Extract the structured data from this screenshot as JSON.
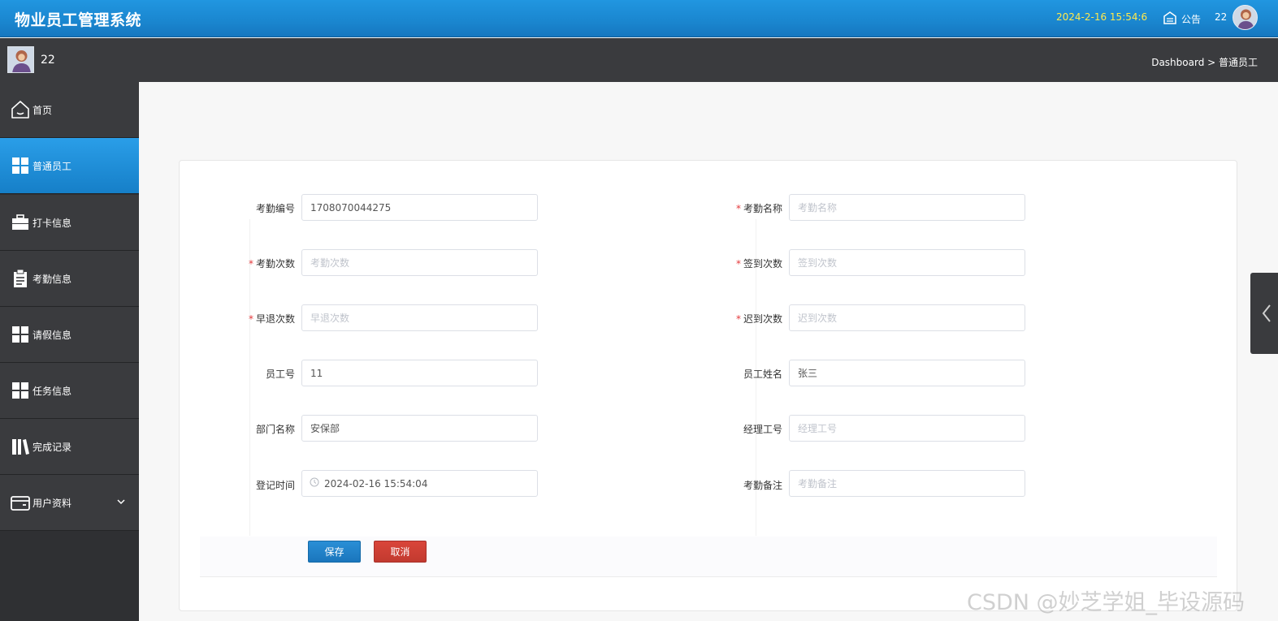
{
  "header": {
    "app_title": "物业员工管理系统",
    "datetime": "2024-2-16 15:54:6",
    "notice_label": "公告",
    "username": "22",
    "notice_icon": "announcement-icon"
  },
  "subbar": {
    "username": "22",
    "breadcrumb": "Dashboard > 普通员工"
  },
  "sidebar": {
    "items": [
      {
        "label": "首页",
        "icon": "home-icon"
      },
      {
        "label": "普通员工",
        "icon": "grid-icon"
      },
      {
        "label": "打卡信息",
        "icon": "briefcase-icon"
      },
      {
        "label": "考勤信息",
        "icon": "clipboard-icon"
      },
      {
        "label": "请假信息",
        "icon": "grid-icon"
      },
      {
        "label": "任务信息",
        "icon": "grid-icon"
      },
      {
        "label": "完成记录",
        "icon": "books-icon"
      },
      {
        "label": "用户资料",
        "icon": "wallet-icon"
      }
    ],
    "active_label": "普通员工"
  },
  "form": {
    "fields": {
      "attendance_no": {
        "label": "考勤编号",
        "value": "1708070044275"
      },
      "attendance_name": {
        "label": "考勤名称",
        "placeholder": "考勤名称",
        "required": true
      },
      "attendance_count": {
        "label": "考勤次数",
        "placeholder": "考勤次数",
        "required": true
      },
      "signin_count": {
        "label": "签到次数",
        "placeholder": "签到次数",
        "required": true
      },
      "early_leave_count": {
        "label": "早退次数",
        "placeholder": "早退次数",
        "required": true
      },
      "late_count": {
        "label": "迟到次数",
        "placeholder": "迟到次数",
        "required": true
      },
      "employee_no": {
        "label": "员工号",
        "value": "11"
      },
      "employee_name": {
        "label": "员工姓名",
        "value": "张三"
      },
      "department": {
        "label": "部门名称",
        "value": "安保部"
      },
      "manager_no": {
        "label": "经理工号",
        "placeholder": "经理工号"
      },
      "register_time": {
        "label": "登记时间",
        "value": "2024-02-16 15:54:04"
      },
      "remark": {
        "label": "考勤备注",
        "placeholder": "考勤备注"
      }
    },
    "required_mark": "*",
    "save_label": "保存",
    "cancel_label": "取消"
  },
  "watermark": "CSDN @妙芝学姐_毕设源码",
  "colors": {
    "header_blue": "#1a86cf",
    "sidebar_dark": "#3a3b3e",
    "active_blue": "#1f8ad6",
    "save_blue": "#1a76bd",
    "cancel_red": "#c23a2f",
    "required_red": "#e4393c",
    "clock_yellow": "#ffe94d"
  }
}
